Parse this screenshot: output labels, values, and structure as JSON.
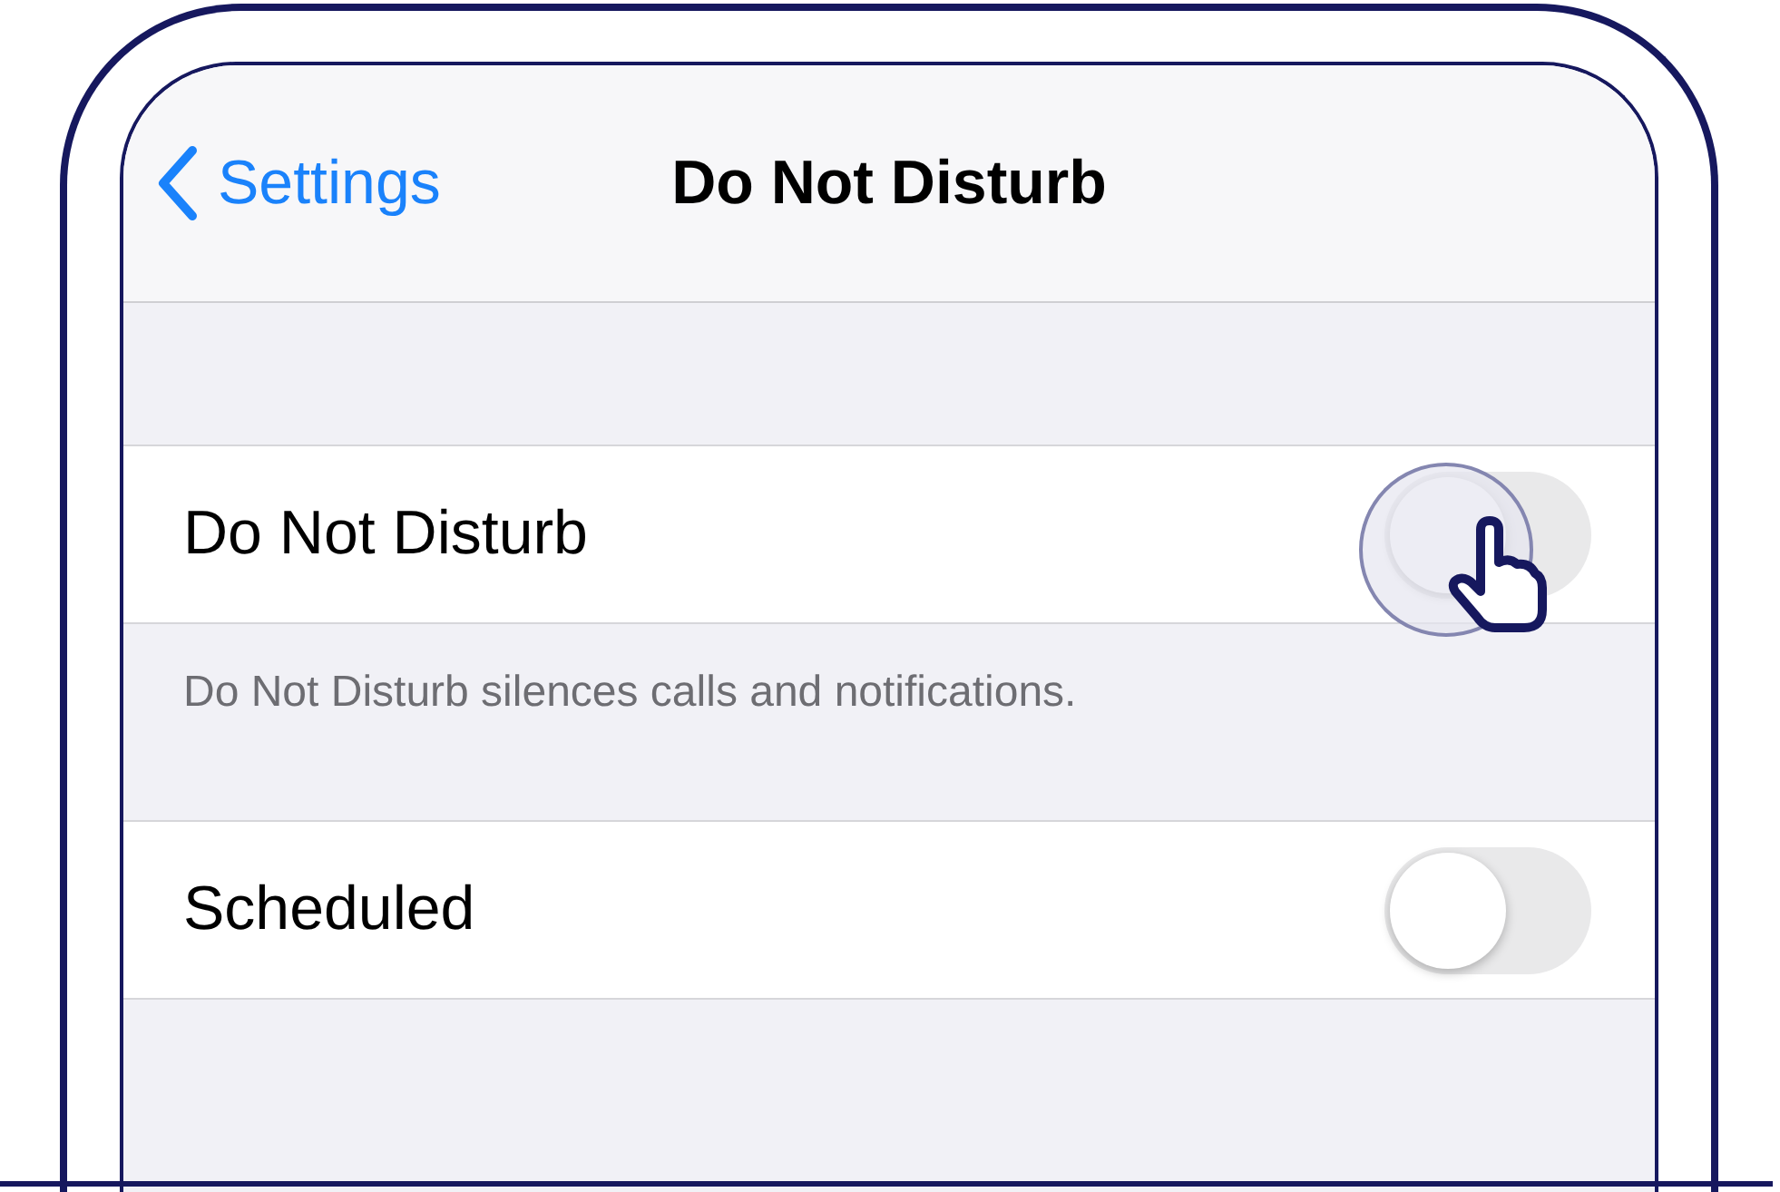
{
  "nav": {
    "back_label": "Settings",
    "title": "Do Not Disturb"
  },
  "rows": [
    {
      "label": "Do Not Disturb",
      "on": false,
      "tapped": true,
      "footer": "Do Not Disturb silences calls and notifications."
    },
    {
      "label": "Scheduled",
      "on": false,
      "tapped": false
    }
  ]
}
